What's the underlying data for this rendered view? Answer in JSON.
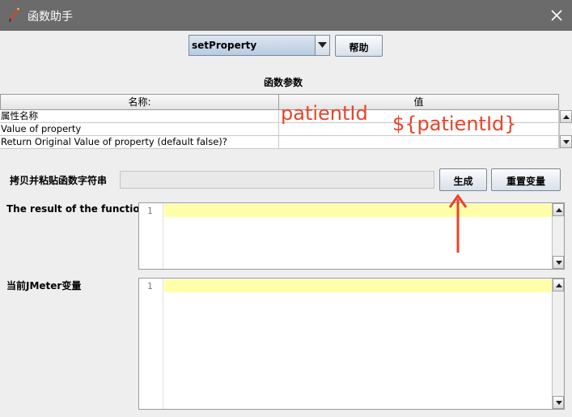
{
  "window": {
    "title": "函数助手",
    "close_icon": "close-icon"
  },
  "function_select": {
    "value": "setProperty"
  },
  "help_button": {
    "label": "帮助"
  },
  "params": {
    "title": "函数参数",
    "columns": [
      "名称:",
      "值"
    ],
    "rows": [
      {
        "name": "属性名称",
        "value": ""
      },
      {
        "name": "Value of property",
        "value": ""
      },
      {
        "name": "Return Original Value of property (default false)?",
        "value": ""
      }
    ]
  },
  "copy_paste": {
    "label": "拷贝并粘贴函数字符串",
    "value": ""
  },
  "generate_button": {
    "label": "生成"
  },
  "reset_button": {
    "label": "重置变量"
  },
  "result": {
    "label": "The result of the function is",
    "line_number": "1"
  },
  "jmeter_vars": {
    "label": "当前JMeter变量",
    "line_number": "1"
  },
  "annotations": {
    "name_text": "patientId",
    "value_text": "${patientId}",
    "color": "#e8442a"
  }
}
